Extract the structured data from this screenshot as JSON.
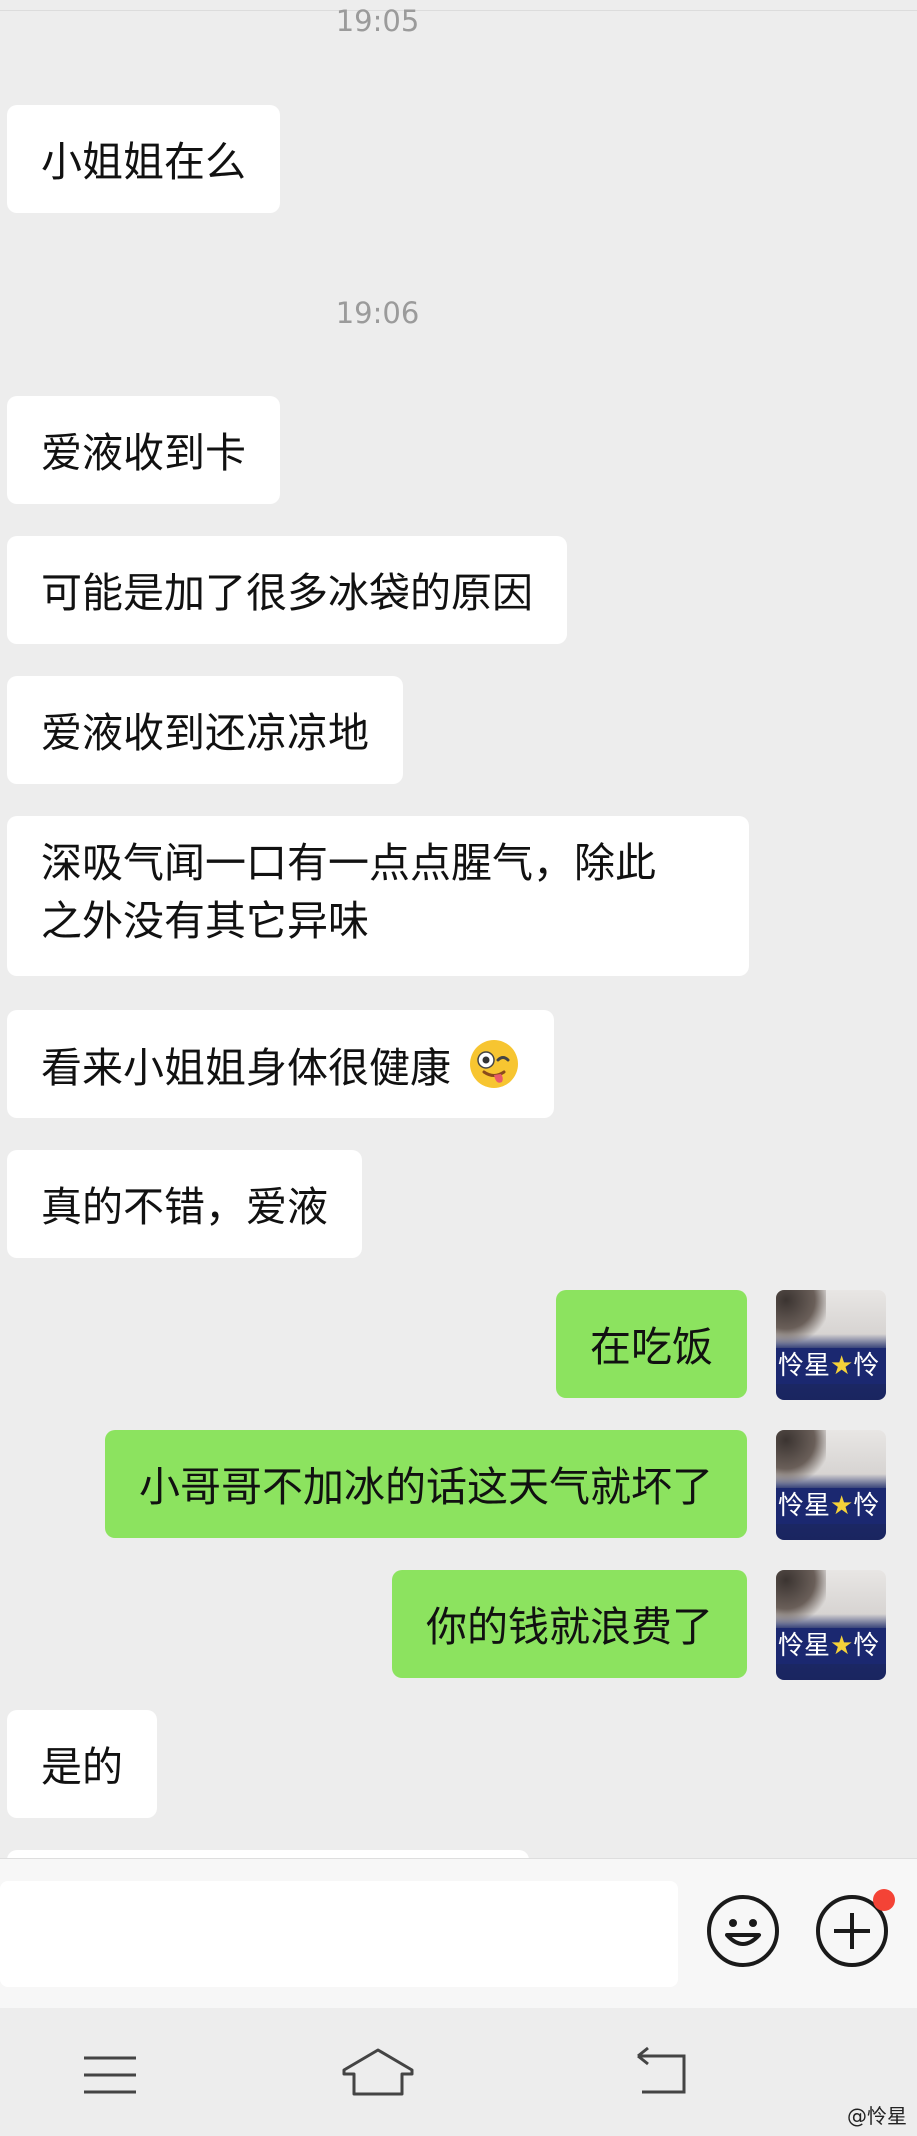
{
  "messages": {
    "time_1": "19:05",
    "time_2": "19:06",
    "m1": "小姐姐在么",
    "m2": "爱液收到卡",
    "m3": "可能是加了很多冰袋的原因",
    "m4": "爱液收到还凉凉地",
    "m5_line1": "深吸气闻一口有一点点腥气，除此",
    "m5_line2": "之外没有其它异味",
    "m6": "看来小姐姐身体很健康",
    "m7": "真的不错，爱液",
    "m8": "在吃饭",
    "m9": "小哥哥不加冰的话这天气就坏了",
    "m10": "你的钱就浪费了",
    "m11": "是的"
  },
  "avatar": {
    "text_a": "怜星",
    "star": "★",
    "text_b": "怜"
  },
  "icons": {
    "emoji_in_message": "winking-tongue-face-icon",
    "emoji_button": "smiley-face-icon",
    "plus_button": "plus-circle-icon",
    "nav_menu": "menu-icon",
    "nav_home": "home-icon",
    "nav_back": "back-icon"
  },
  "colors": {
    "chat_background": "#ededed",
    "incoming_bubble": "#ffffff",
    "outgoing_bubble": "#8ce35f",
    "notification_dot": "#f44336"
  },
  "watermark": "@怜星"
}
